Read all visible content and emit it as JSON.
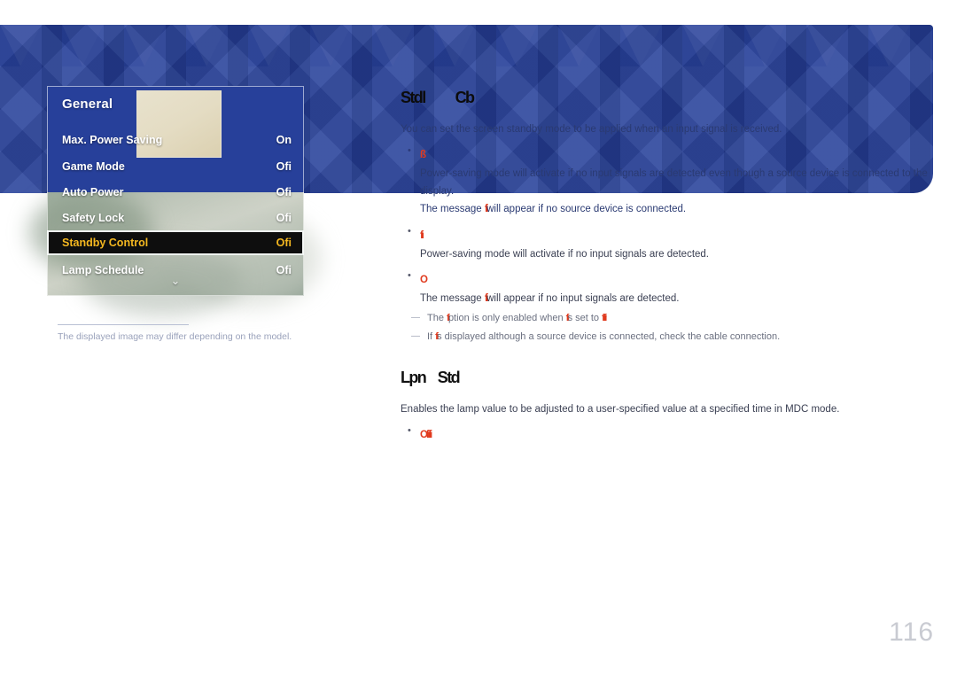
{
  "page": {
    "number": "116",
    "background_color": "#ffffff"
  },
  "banner": {
    "color": "#27409a",
    "pattern": "chevron-geometric"
  },
  "osd_figure": {
    "menu_title": "General",
    "thumbnail_color": "#e4dcc3",
    "scroll_chevron": "⌄",
    "rows": [
      {
        "label": "Max. Power Saving",
        "value": "On",
        "selected": false
      },
      {
        "label": "Game Mode",
        "value": "Ofi",
        "selected": false
      },
      {
        "label": "Auto Power",
        "value": "Ofi",
        "selected": false
      },
      {
        "label": "Safety Lock",
        "value": "Ofi",
        "selected": false
      },
      {
        "label": "Standby Control",
        "value": "Ofi",
        "selected": true
      },
      {
        "label": "Lamp Schedule",
        "value": "Ofi",
        "selected": false
      }
    ],
    "highlight_color": "#f5b820",
    "caption": "The displayed image may differ depending on the model."
  },
  "content": {
    "section1": {
      "heading": "Stdl          Cb",
      "intro": "You can set the screen standby mode to be applied when an input signal is received.",
      "options": [
        {
          "label": "ß",
          "lines": [
            "Power-saving mode will activate if no input signals are detected even though a source device is connected to the display.",
            "The message  will appear if no source device is connected."
          ],
          "inline_option": "fi"
        },
        {
          "label": "fi",
          "lines": [
            "Power-saving mode will activate if no input signals are detected."
          ],
          "inline_option": ""
        },
        {
          "label": "O",
          "lines": [
            "The message  will appear if no input signals are detected."
          ],
          "inline_option": "fi"
        }
      ],
      "notes": [
        {
          "prefix": "The ",
          "opt1": "fi",
          "middle": "ption is only enabled when ",
          "opt2": "fi",
          "middle2": "s set to ",
          "opt3": "fifi"
        },
        {
          "prefix": "If ",
          "opt1": "fi",
          "middle": "s displayed although a source device is connected, check the cable connection.",
          "opt2": "",
          "middle2": "",
          "opt3": ""
        }
      ]
    },
    "section2": {
      "heading": "Lpn    Std",
      "intro": "Enables the lamp value to be adjusted to a user-specified value at a specified time in MDC mode.",
      "options": [
        {
          "label": "Ofifi"
        }
      ]
    }
  }
}
